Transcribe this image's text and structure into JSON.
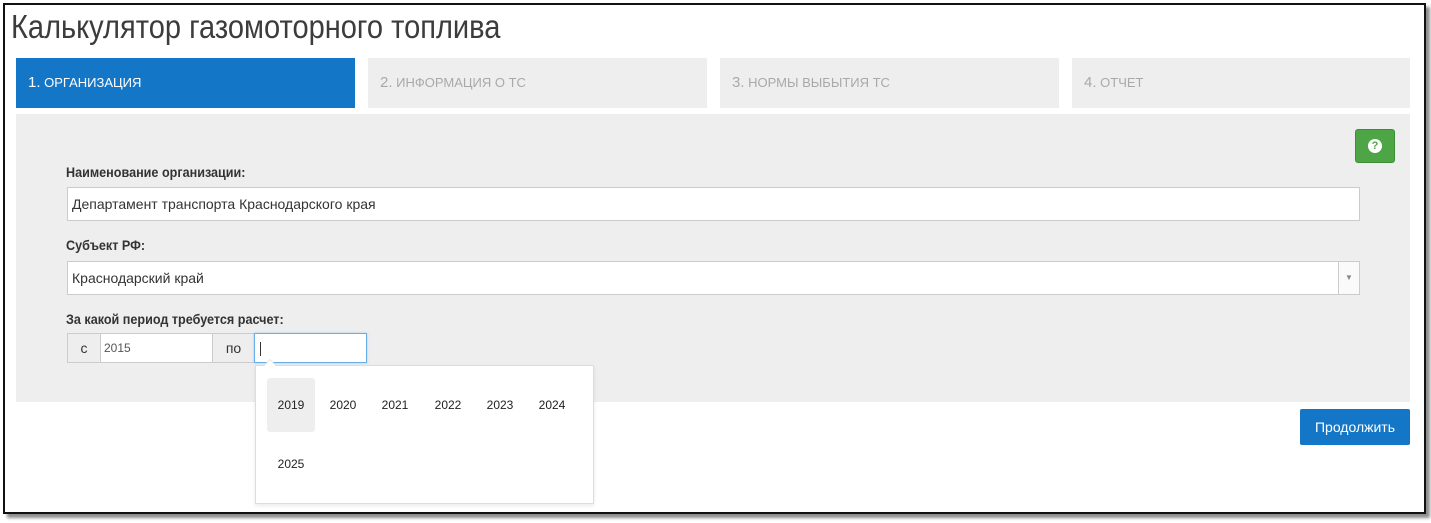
{
  "app": {
    "title": "Калькулятор газомоторного топлива"
  },
  "tabs": [
    {
      "num": "1.",
      "label": "ОРГАНИЗАЦИЯ",
      "active": true
    },
    {
      "num": "2.",
      "label": "ИНФОРМАЦИЯ О ТС",
      "active": false
    },
    {
      "num": "3.",
      "label": "НОРМЫ ВЫБЫТИЯ ТС",
      "active": false
    },
    {
      "num": "4.",
      "label": "ОТЧЕТ",
      "active": false
    }
  ],
  "form": {
    "org_label": "Наименование организации:",
    "org_value": "Департамент транспорта Краснодарского края",
    "region_label": "Субъект РФ:",
    "region_value": "Краснодарский край",
    "period_label": "За какой период требуется расчет:",
    "from_addon": "с",
    "from_value": "2015",
    "to_addon": "по",
    "to_value": ""
  },
  "year_picker": {
    "years": [
      "2019",
      "2020",
      "2021",
      "2022",
      "2023",
      "2024",
      "2025"
    ],
    "hovered": "2019"
  },
  "buttons": {
    "continue_label": "Продолжить",
    "help_icon": "question-circle-icon"
  },
  "colors": {
    "accent": "#1476c6",
    "help": "#4ea546",
    "panel": "#eeeeee"
  }
}
